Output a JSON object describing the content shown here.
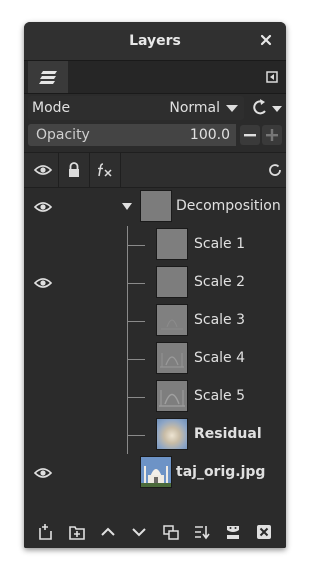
{
  "window": {
    "title": "Layers"
  },
  "mode": {
    "label": "Mode",
    "value": "Normal"
  },
  "opacity": {
    "label": "Opacity",
    "value": "100.0",
    "fraction": 1.0
  },
  "layers": [
    {
      "name": "Decomposition",
      "visible": true,
      "group": true,
      "expanded": true
    },
    {
      "name": "Scale 1",
      "visible": false,
      "child": true
    },
    {
      "name": "Scale 2",
      "visible": true,
      "child": true
    },
    {
      "name": "Scale 3",
      "visible": false,
      "child": true
    },
    {
      "name": "Scale 4",
      "visible": false,
      "child": true
    },
    {
      "name": "Scale 5",
      "visible": false,
      "child": true
    },
    {
      "name": "Residual",
      "visible": false,
      "child": true,
      "bold": true
    },
    {
      "name": "taj_orig.jpg",
      "visible": true,
      "bold": true
    }
  ],
  "colors": {
    "background": "#2b2b2b",
    "text": "#e0e0e0",
    "thumb_gray": "#7c7c7c"
  },
  "icons": {
    "close": "close-icon",
    "tab": "layers-stack-icon",
    "tab_menu": "tab-menu-icon",
    "reset": "reset-icon",
    "eye": "eye-icon",
    "lock": "lock-icon",
    "fx": "effects-icon",
    "refresh": "refresh-icon",
    "bottom": [
      "new-layer-icon",
      "new-group-icon",
      "raise-icon",
      "lower-icon",
      "duplicate-icon",
      "merge-down-icon",
      "mask-icon",
      "delete-icon"
    ]
  }
}
